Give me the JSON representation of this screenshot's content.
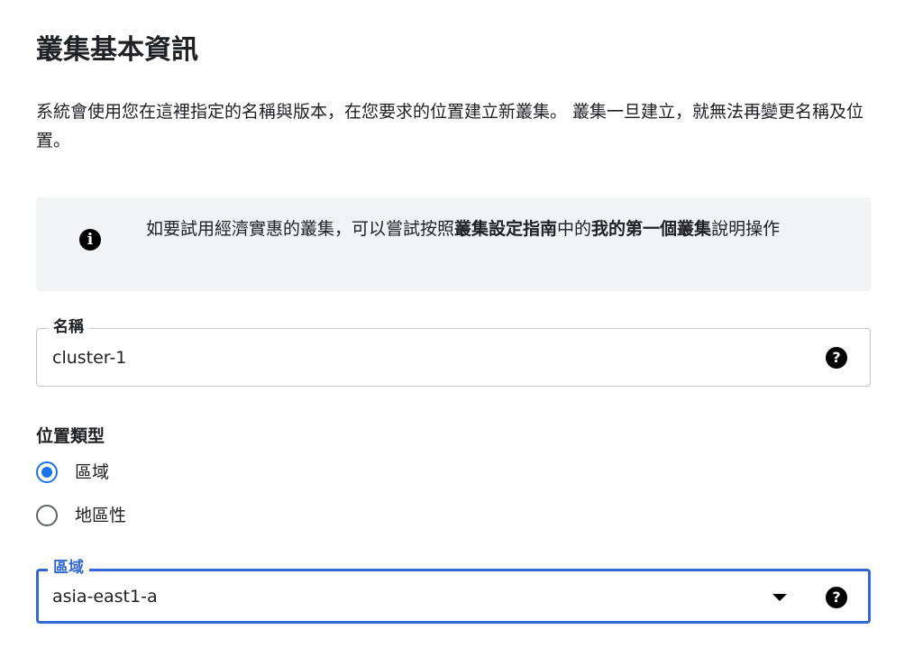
{
  "header": {
    "title": "叢集基本資訊",
    "description": "系統會使用您在這裡指定的名稱與版本，在您要求的位置建立新叢集。 叢集一旦建立，就無法再變更名稱及位置。"
  },
  "info_banner": {
    "icon": "info-icon",
    "text_before": "如要試用經濟實惠的叢集，可以嘗試按照",
    "guide_link": "叢集設定指南",
    "text_middle": "中的",
    "tutorial_link": "我的第一個叢集",
    "text_after": "說明操作"
  },
  "name_field": {
    "label": "名稱",
    "value": "cluster-1",
    "help_icon": "help-icon"
  },
  "location_type": {
    "label": "位置類型",
    "options": [
      {
        "label": "區域",
        "checked": true
      },
      {
        "label": "地區性",
        "checked": false
      }
    ]
  },
  "zone_field": {
    "label": "區域",
    "value": "asia-east1-a",
    "help_icon": "help-icon",
    "dropdown_icon": "dropdown-arrow-icon"
  },
  "colors": {
    "accent": "#1a73e8",
    "focus_border": "#3367d6",
    "banner_bg": "#f1f3f4",
    "text": "#202124"
  }
}
